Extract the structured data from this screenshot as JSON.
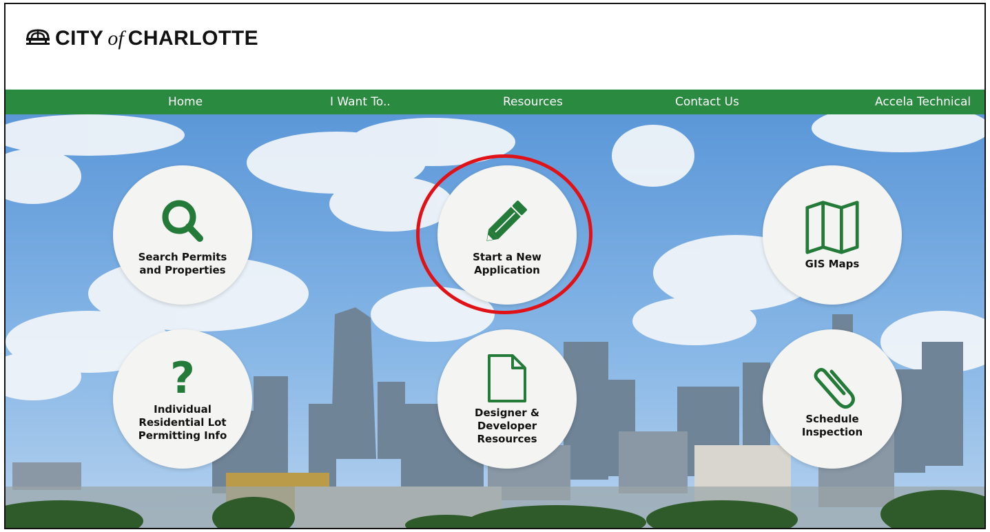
{
  "brand": {
    "city": "CITY",
    "of": "of",
    "name": "CHARLOTTE",
    "crown_icon": "crown-icon"
  },
  "nav": {
    "items": [
      {
        "label": "Home"
      },
      {
        "label": "I Want To.."
      },
      {
        "label": "Resources"
      },
      {
        "label": "Contact Us"
      },
      {
        "label": "Accela Technical"
      }
    ]
  },
  "tiles": [
    {
      "label": "Search Permits and Properties",
      "icon": "search-icon"
    },
    {
      "label": "Start a New Application",
      "icon": "pencil-icon"
    },
    {
      "label": "GIS Maps",
      "icon": "map-icon"
    },
    {
      "label": "Individual Residential Lot Permitting Info",
      "icon": "question-icon"
    },
    {
      "label": "Designer & Developer Resources",
      "icon": "document-icon"
    },
    {
      "label": "Schedule Inspection",
      "icon": "paperclip-icon"
    }
  ],
  "colors": {
    "nav_green": "#2a8a3f",
    "icon_green": "#237a39",
    "highlight_red": "#e01218",
    "tile_bg": "#f4f4f2"
  }
}
